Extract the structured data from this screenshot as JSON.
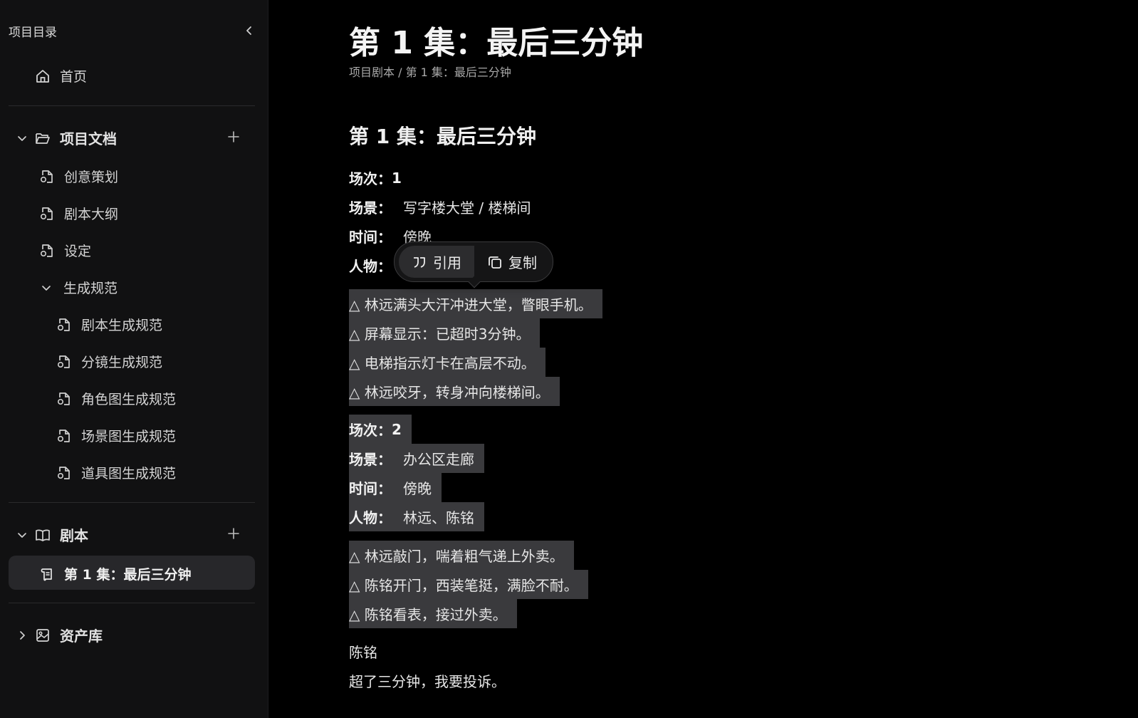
{
  "sidebar": {
    "title": "项目目录",
    "home": "首页",
    "docs_section": {
      "label": "项目文档",
      "items": [
        "创意策划",
        "剧本大纲",
        "设定"
      ],
      "group": {
        "label": "生成规范",
        "items": [
          "剧本生成规范",
          "分镜生成规范",
          "角色图生成规范",
          "场景图生成规范",
          "道具图生成规范"
        ]
      }
    },
    "script_section": {
      "label": "剧本",
      "items": [
        "第 1 集：最后三分钟"
      ]
    },
    "assets_section": {
      "label": "资产库"
    }
  },
  "main": {
    "title": "第 1 集：最后三分钟",
    "breadcrumb": "项目剧本 / 第 1 集：最后三分钟",
    "heading": "第 1 集：最后三分钟",
    "scene1": {
      "no_label": "场次：",
      "no_value": "1",
      "place_label": "场景：",
      "place_value": "写字楼大堂 / 楼梯间",
      "time_label": "时间：",
      "time_value": "傍晚",
      "people_label": "人物：",
      "actions": [
        "△ 林远满头大汗冲进大堂，瞥眼手机。",
        "△ 屏幕显示：已超时3分钟。",
        "△ 电梯指示灯卡在高层不动。",
        "△ 林远咬牙，转身冲向楼梯间。"
      ]
    },
    "scene2": {
      "no_label": "场次：",
      "no_value": "2",
      "place_label": "场景：",
      "place_value": "办公区走廊",
      "time_label": "时间：",
      "time_value": "傍晚",
      "people_label": "人物：",
      "people_value": "林远、陈铭",
      "actions": [
        "△ 林远敲门，喘着粗气递上外卖。",
        "△ 陈铭开门，西装笔挺，满脸不耐。",
        "△ 陈铭看表，接过外卖。"
      ]
    },
    "dialogue": {
      "speaker": "陈铭",
      "line": "超了三分钟，我要投诉。"
    }
  },
  "popup": {
    "quote_label": "引用",
    "copy_label": "复制"
  }
}
